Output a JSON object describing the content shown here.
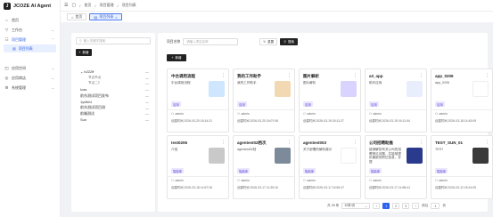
{
  "brand": {
    "logo": "J",
    "name": "JCOZE AI Agent"
  },
  "sidebar": {
    "items": [
      {
        "label": "首页",
        "icon": "home-icon"
      },
      {
        "label": "工作台",
        "icon": "workbench-icon"
      },
      {
        "label": "项目管理",
        "icon": "project-icon"
      },
      {
        "label": "项目列表",
        "icon": "list-icon"
      },
      {
        "label": "应用空间",
        "icon": "app-space-icon"
      },
      {
        "label": "应用商店",
        "icon": "store-icon"
      },
      {
        "label": "系统管理",
        "icon": "settings-icon"
      }
    ]
  },
  "topbar": {
    "breadcrumb": [
      "首页",
      "项目管理",
      "项目列表"
    ]
  },
  "tabs": [
    {
      "label": "首页"
    },
    {
      "label": "项目列表"
    }
  ],
  "tree_panel": {
    "search_placeholder": "输入关键字搜索",
    "add_label": "新增",
    "nodes": [
      {
        "label": "b222ff",
        "level": 1
      },
      {
        "label": "节点节点",
        "level": 2
      },
      {
        "label": "节点二2",
        "level": 2
      },
      {
        "label": "Icas",
        "level": 1
      },
      {
        "label": "前东测试项目发布",
        "level": 1
      },
      {
        "label": "1ydfcid",
        "level": 1
      },
      {
        "label": "前东测试项目测",
        "level": 1
      },
      {
        "label": "前端测试",
        "level": 1
      },
      {
        "label": "Sun",
        "level": 1
      }
    ]
  },
  "filter": {
    "label": "项目名称",
    "placeholder": "请输入项目名称",
    "reset_label": "重置",
    "search_label": "搜索",
    "add_label": "新增"
  },
  "cards": [
    {
      "title": "中台调用流程",
      "desc": "中台调用流程",
      "badge": "应用",
      "creator": "admin",
      "created_prefix": "创建时间",
      "time": "2026-03-20 18:14:21",
      "thumb_color": "#cfe6ff"
    },
    {
      "title": "我的工作助手",
      "desc": "我的工作助手",
      "badge": "应用",
      "creator": "admin",
      "created_prefix": "创建时间",
      "time": "2026-03-20 16:07:06",
      "thumb_color": "#f2d9b3"
    },
    {
      "title": "图片解析",
      "desc": "图片解析",
      "badge": "应用",
      "creator": "admin",
      "created_prefix": "创建时间",
      "time": "2026-03-19 18:11:27",
      "thumb_color": "#d9d3ff"
    },
    {
      "title": "a3_app",
      "desc": "助手应用",
      "badge": "应用",
      "creator": "admin",
      "created_prefix": "创建时间",
      "time": "2026-03-19 16:11:04",
      "thumb_color": "#e8eefc"
    },
    {
      "title": "app_0206",
      "desc": "app_0206",
      "badge": "应用",
      "creator": "admin",
      "created_prefix": "创建时间",
      "time": "2026-03-18 14:43:09",
      "thumb_color": "#ffffff"
    },
    {
      "title": "test0206",
      "desc": "介绍",
      "badge": "智能体",
      "creator": "admin",
      "created_prefix": "创建时间",
      "time": "2026-03-18 14:57:26",
      "thumb_color": "#c9c9c9"
    },
    {
      "title": "agentest02档次",
      "desc": "agentest02档",
      "badge": "智能体",
      "creator": "admin",
      "created_prefix": "创建时间",
      "time": "2026-03-17 11:35:16",
      "thumb_color": "#7d8a99"
    },
    {
      "title": "agentest003",
      "desc": "关于部署的解析展示",
      "badge": "智能体",
      "creator": "admin",
      "created_prefix": "创建时间",
      "time": "2026-03-17 16:50:47",
      "thumb_color": "#ffffff"
    },
    {
      "title": "公司招聘助推",
      "desc": "能够解答有关公司的招聘常见问题，并能够提供最新的职位信息，并提",
      "badge": "智能体",
      "creator": "admin",
      "created_prefix": "创建时间",
      "time": "2026-03-17 14:58:41",
      "thumb_color": "#2a3a8c"
    },
    {
      "title": "TEST_SUN_01",
      "desc": "TEST",
      "badge": "智能体",
      "creator": "admin",
      "created_prefix": "创建时间",
      "time": "2026-03-12 18:24:05",
      "thumb_color": "#3a3a3a"
    }
  ],
  "pager": {
    "total": "共 28 条",
    "page_size": "10条/页",
    "pages": [
      "1",
      "2",
      "3"
    ],
    "goto_prefix": "前往",
    "goto_value": "1",
    "goto_suffix": "页"
  }
}
